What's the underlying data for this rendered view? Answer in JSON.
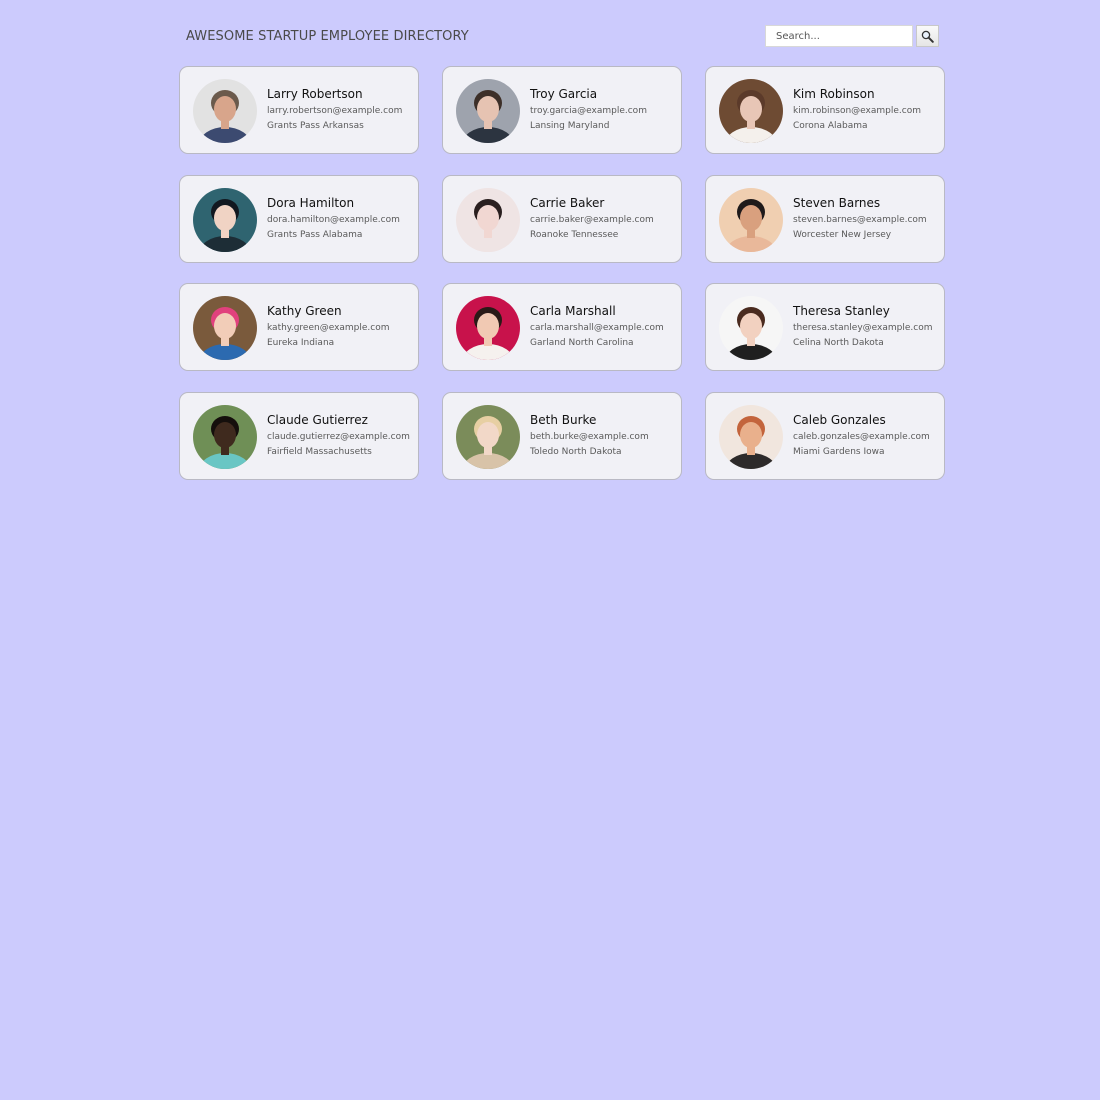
{
  "header": {
    "title": "AWESOME STARTUP EMPLOYEE DIRECTORY",
    "search_placeholder": "Search...",
    "search_icon": "magnifier-icon"
  },
  "employees": [
    {
      "name": "Larry Robertson",
      "email": "larry.robertson@example.com",
      "location": "Grants Pass Arkansas",
      "avatar": {
        "bg": "#e2e2e2",
        "skin": "#d8a58b",
        "hair": "#6b5a4c",
        "shirt": "#3c4a70"
      }
    },
    {
      "name": "Troy Garcia",
      "email": "troy.garcia@example.com",
      "location": "Lansing Maryland",
      "avatar": {
        "bg": "#9ea3ad",
        "skin": "#e6c3b2",
        "hair": "#3d2f28",
        "shirt": "#2c3440"
      }
    },
    {
      "name": "Kim Robinson",
      "email": "kim.robinson@example.com",
      "location": "Corona Alabama",
      "avatar": {
        "bg": "#6e4b33",
        "skin": "#e8c6b6",
        "hair": "#5b3a2a",
        "shirt": "#f4f0ec"
      }
    },
    {
      "name": "Dora Hamilton",
      "email": "dora.hamilton@example.com",
      "location": "Grants Pass Alabama",
      "avatar": {
        "bg": "#2f6470",
        "skin": "#f0d3c4",
        "hair": "#121820",
        "shirt": "#1d2d36"
      }
    },
    {
      "name": "Carrie Baker",
      "email": "carrie.baker@example.com",
      "location": "Roanoke Tennessee",
      "avatar": {
        "bg": "#efe4e4",
        "skin": "#f1d7d2",
        "hair": "#2a1f1f",
        "shirt": "#efe4e4"
      }
    },
    {
      "name": "Steven Barnes",
      "email": "steven.barnes@example.com",
      "location": "Worcester New Jersey",
      "avatar": {
        "bg": "#f0cfb1",
        "skin": "#d9a07e",
        "hair": "#1f1a1a",
        "shirt": "#e9b89a"
      }
    },
    {
      "name": "Kathy Green",
      "email": "kathy.green@example.com",
      "location": "Eureka Indiana",
      "avatar": {
        "bg": "#7a5a3c",
        "skin": "#f2cdb8",
        "hair": "#e1417d",
        "shirt": "#2c6ab0"
      }
    },
    {
      "name": "Carla Marshall",
      "email": "carla.marshall@example.com",
      "location": "Garland North Carolina",
      "avatar": {
        "bg": "#c8124b",
        "skin": "#f1c9b3",
        "hair": "#2a1a17",
        "shirt": "#f5f1ee"
      }
    },
    {
      "name": "Theresa Stanley",
      "email": "theresa.stanley@example.com",
      "location": "Celina North Dakota",
      "avatar": {
        "bg": "#f6f6f6",
        "skin": "#f2d1c0",
        "hair": "#4a2b1f",
        "shirt": "#1f1f1f"
      }
    },
    {
      "name": "Claude Gutierrez",
      "email": "claude.gutierrez@example.com",
      "location": "Fairfield Massachusetts",
      "avatar": {
        "bg": "#6f8f56",
        "skin": "#3f2a1e",
        "hair": "#150f0c",
        "shirt": "#69c6c4"
      }
    },
    {
      "name": "Beth Burke",
      "email": "beth.burke@example.com",
      "location": "Toledo North Dakota",
      "avatar": {
        "bg": "#7b8c5a",
        "skin": "#f2d8c8",
        "hair": "#e7cfa3",
        "shirt": "#d8c3a8"
      }
    },
    {
      "name": "Caleb Gonzales",
      "email": "caleb.gonzales@example.com",
      "location": "Miami Gardens Iowa",
      "avatar": {
        "bg": "#f1e6de",
        "skin": "#e9b08c",
        "hair": "#c3643c",
        "shirt": "#2d2a2a"
      }
    }
  ]
}
